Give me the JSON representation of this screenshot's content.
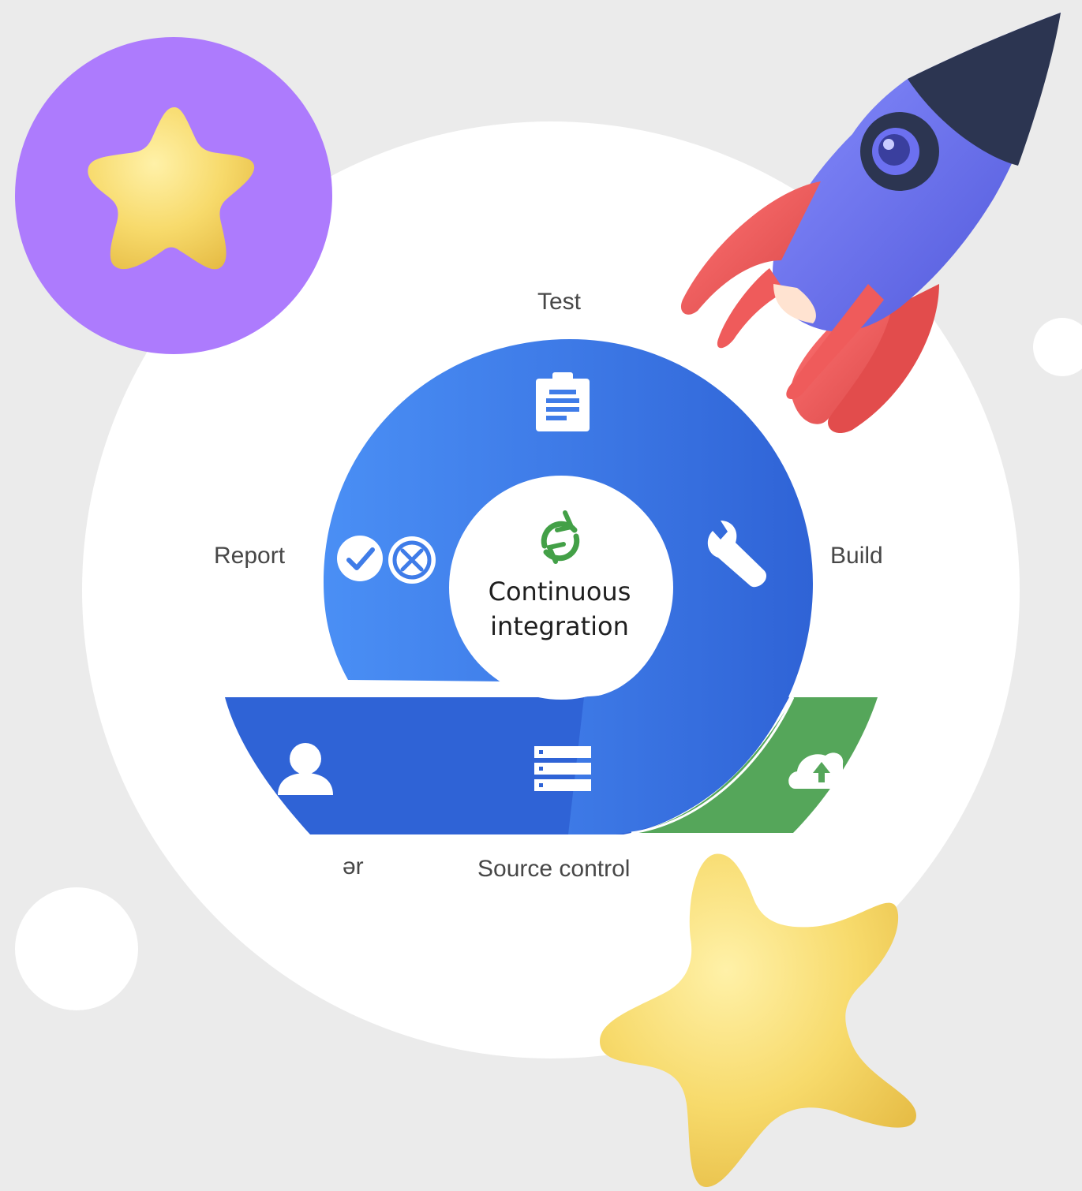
{
  "diagram": {
    "center": {
      "line1": "Continuous",
      "line2": "integration"
    },
    "stages": {
      "test": "Test",
      "build": "Build",
      "report": "Report",
      "source_control": "Source control",
      "truncated_left": "ər"
    }
  },
  "colors": {
    "background": "#ebebeb",
    "blue_light": "#4a8ff5",
    "blue_dark": "#2f63d6",
    "green": "#55a65a",
    "purple": "#ad7bfd",
    "star_yellow": "#f6d86a",
    "rocket_body": "#6c70f0",
    "rocket_nose": "#2c3551",
    "rocket_fin": "#ef5b5b"
  },
  "icons": [
    "clipboard-icon",
    "wrench-icon",
    "check-icon",
    "cancel-icon",
    "sync-icon",
    "person-icon",
    "server-icon",
    "cloud-upload-icon",
    "star-icon",
    "rocket-icon"
  ]
}
